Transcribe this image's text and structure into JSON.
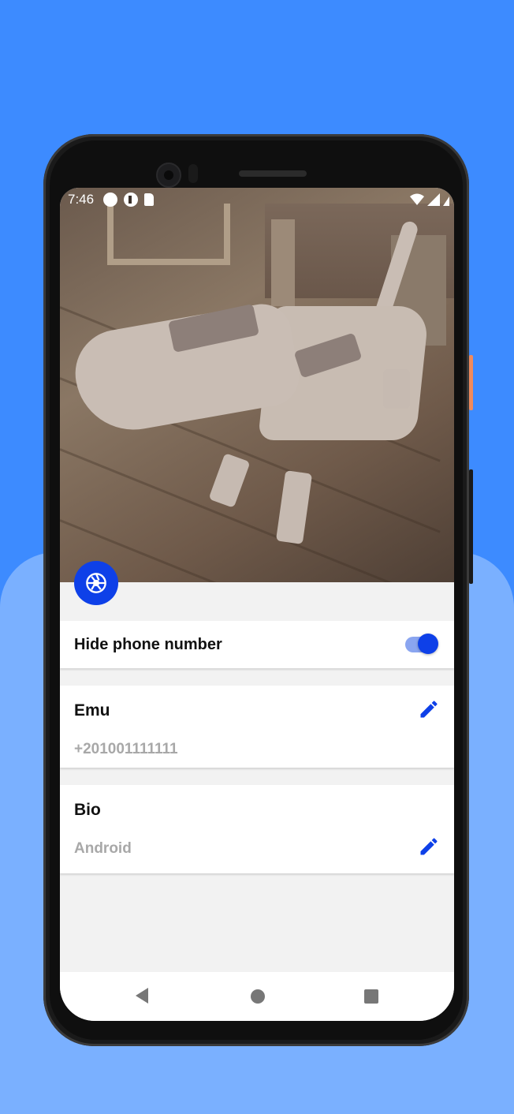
{
  "status_bar": {
    "time": "7:46"
  },
  "photo": {
    "alt": ""
  },
  "settings": {
    "hide_phone_label": "Hide phone number",
    "hide_phone_enabled": true
  },
  "profile": {
    "name": "Emu",
    "phone": "+201001111111",
    "bio_title": "Bio",
    "bio_value": "Android"
  },
  "colors": {
    "accent": "#0e40e8",
    "background_top": "#3d8bff",
    "background_bottom": "#7ab0ff"
  },
  "icons": {
    "avatar_button": "camera-shutter-icon",
    "edit": "pencil-icon"
  }
}
